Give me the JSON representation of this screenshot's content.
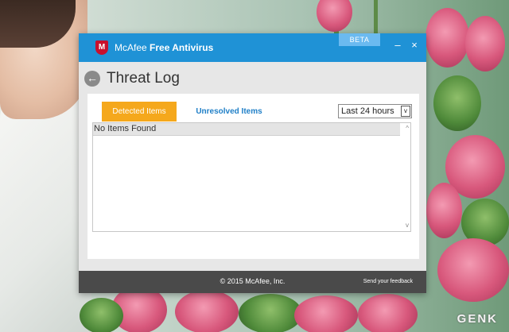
{
  "window": {
    "brand": "McAfee",
    "product": "Free Antivirus",
    "beta_badge": "BETA",
    "minimize_glyph": "–",
    "close_glyph": "×",
    "logo_letter": "M",
    "accent_color": "#1f92d6"
  },
  "page": {
    "back_glyph": "←",
    "title": "Threat Log"
  },
  "tabs": [
    {
      "label": "Detected Items",
      "active": true
    },
    {
      "label": "Unresolved Items",
      "active": false
    }
  ],
  "filter": {
    "selected": "Last 24 hours",
    "arrow_glyph": "v"
  },
  "list": {
    "empty_message": "No Items Found",
    "scroll_up_glyph": "^",
    "scroll_down_glyph": "v"
  },
  "footer": {
    "copyright": "© 2015 McAfee, Inc.",
    "feedback_link": "Send your feedback"
  },
  "watermark": {
    "text": "GENK"
  },
  "icons": [
    "mcafee-logo-icon",
    "back-arrow-icon",
    "minimize-icon",
    "close-icon",
    "dropdown-arrow-icon"
  ]
}
